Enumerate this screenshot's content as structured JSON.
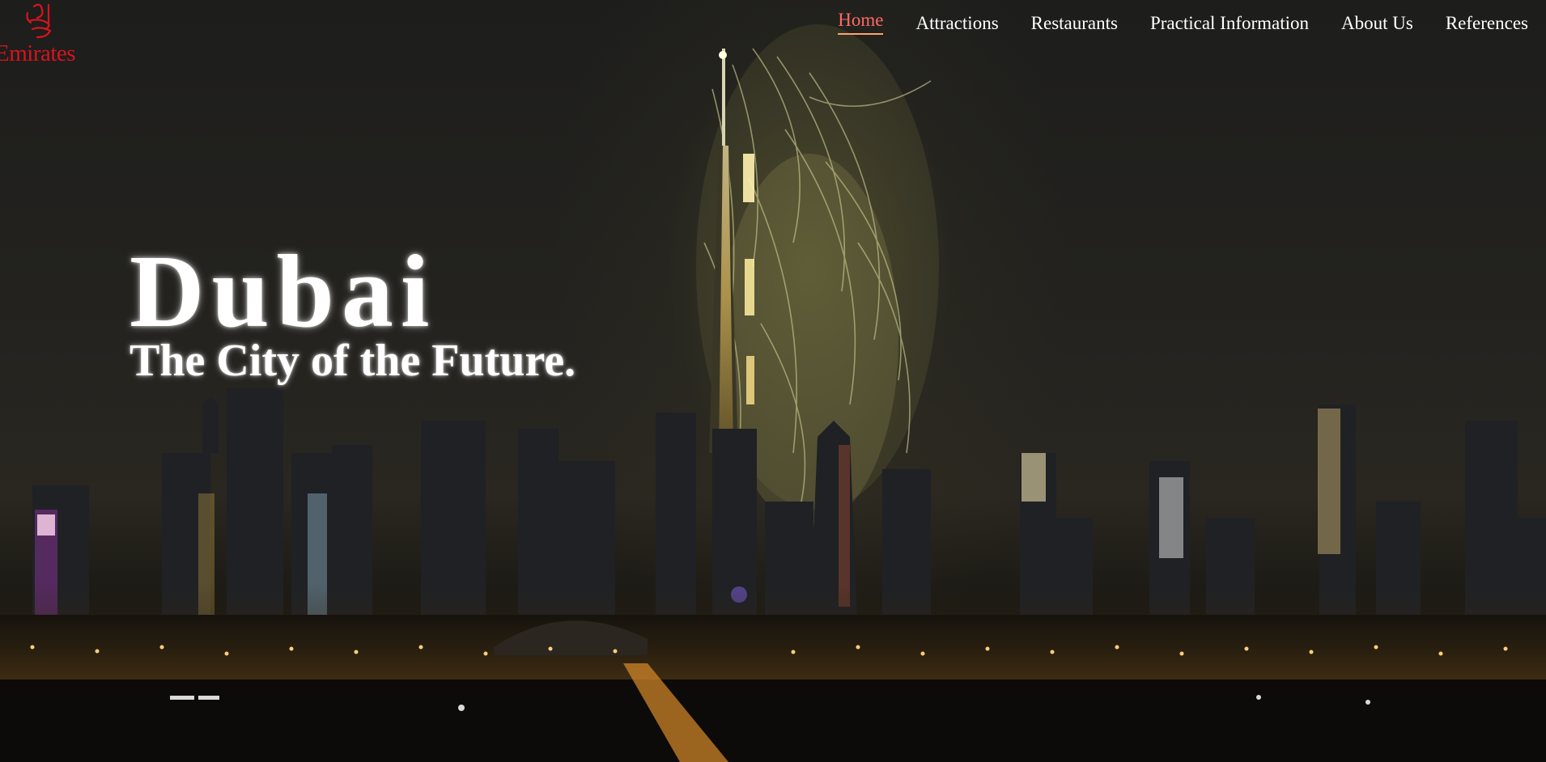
{
  "brand": {
    "name": "Emirates",
    "color": "#d7141d"
  },
  "nav": {
    "items": [
      {
        "label": "Home",
        "active": true
      },
      {
        "label": "Attractions",
        "active": false
      },
      {
        "label": "Restaurants",
        "active": false
      },
      {
        "label": "Practical Information",
        "active": false
      },
      {
        "label": "About Us",
        "active": false
      },
      {
        "label": "References",
        "active": false
      }
    ],
    "active_color": "#ff6a66",
    "text_color": "#ffffff"
  },
  "hero": {
    "title": "Dubai",
    "subtitle": "The City of the Future.",
    "background": "night-skyline-fireworks-image"
  }
}
